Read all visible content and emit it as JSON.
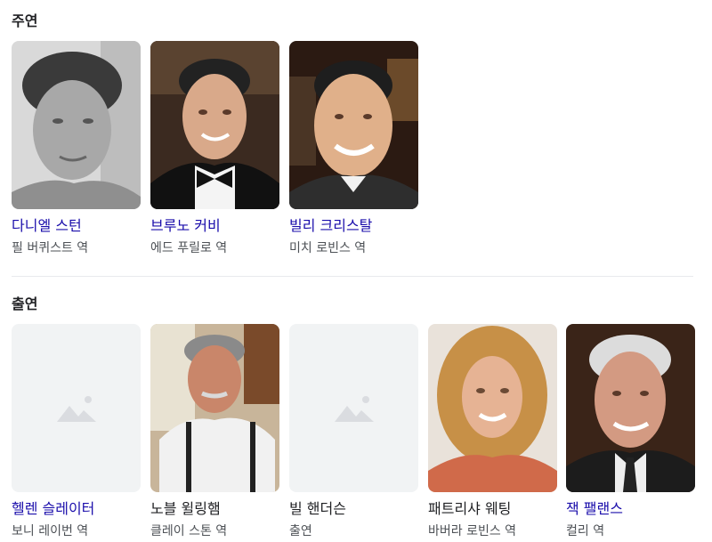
{
  "sections": [
    {
      "title": "주연",
      "cards": [
        {
          "name": "다니엘 스턴",
          "role": "필 버퀴스트 역",
          "photo": "bw-portrait-curly-hair",
          "is_link": true
        },
        {
          "name": "브루노 커비",
          "role": "에드 푸릴로 역",
          "photo": "portrait-bowtie",
          "is_link": true
        },
        {
          "name": "빌리 크리스탈",
          "role": "미치 로빈스 역",
          "photo": "portrait-smiling-suit",
          "is_link": true
        }
      ]
    },
    {
      "title": "출연",
      "cards": [
        {
          "name": "헬렌 슬레이터",
          "role": "보니 레이번 역",
          "photo": "image-placeholder-icon",
          "is_link": true
        },
        {
          "name": "노블 윌링햄",
          "role": "클레이 스톤 역",
          "photo": "portrait-suspenders",
          "is_link": false
        },
        {
          "name": "빌 핸더슨",
          "role": "출연",
          "photo": "image-placeholder-icon",
          "is_link": false
        },
        {
          "name": "패트리샤 웨팅",
          "role": "바버라 로빈스 역",
          "photo": "portrait-blonde-woman",
          "is_link": false
        },
        {
          "name": "잭 팰랜스",
          "role": "컬리 역",
          "photo": "portrait-older-man",
          "is_link": true
        }
      ]
    }
  ],
  "colors": {
    "link": "#1a0dab",
    "text": "#202124",
    "secondary": "#4d5156",
    "placeholder_bg": "#f1f3f4",
    "placeholder_icon": "#dadce0",
    "divider": "#e8eaed"
  }
}
